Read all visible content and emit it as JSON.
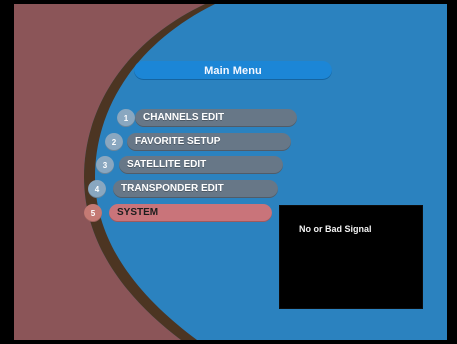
{
  "title": "Main Menu",
  "menu_items": [
    {
      "number": "1",
      "label": "CHANNELS EDIT"
    },
    {
      "number": "2",
      "label": "FAVORITE SETUP"
    },
    {
      "number": "3",
      "label": "SATELLITE EDIT"
    },
    {
      "number": "4",
      "label": "TRANSPONDER EDIT"
    },
    {
      "number": "5",
      "label": "SYSTEM"
    }
  ],
  "selected_item": "SYSTEM",
  "preview": {
    "status_text": "No or Bad Signal"
  },
  "colors": {
    "background_blue": "#2b82bf",
    "menu_pill": "#677787",
    "selected_pill": "#c9747a",
    "title_bar": "#1c86d6",
    "left_panel": "#8b5558"
  }
}
